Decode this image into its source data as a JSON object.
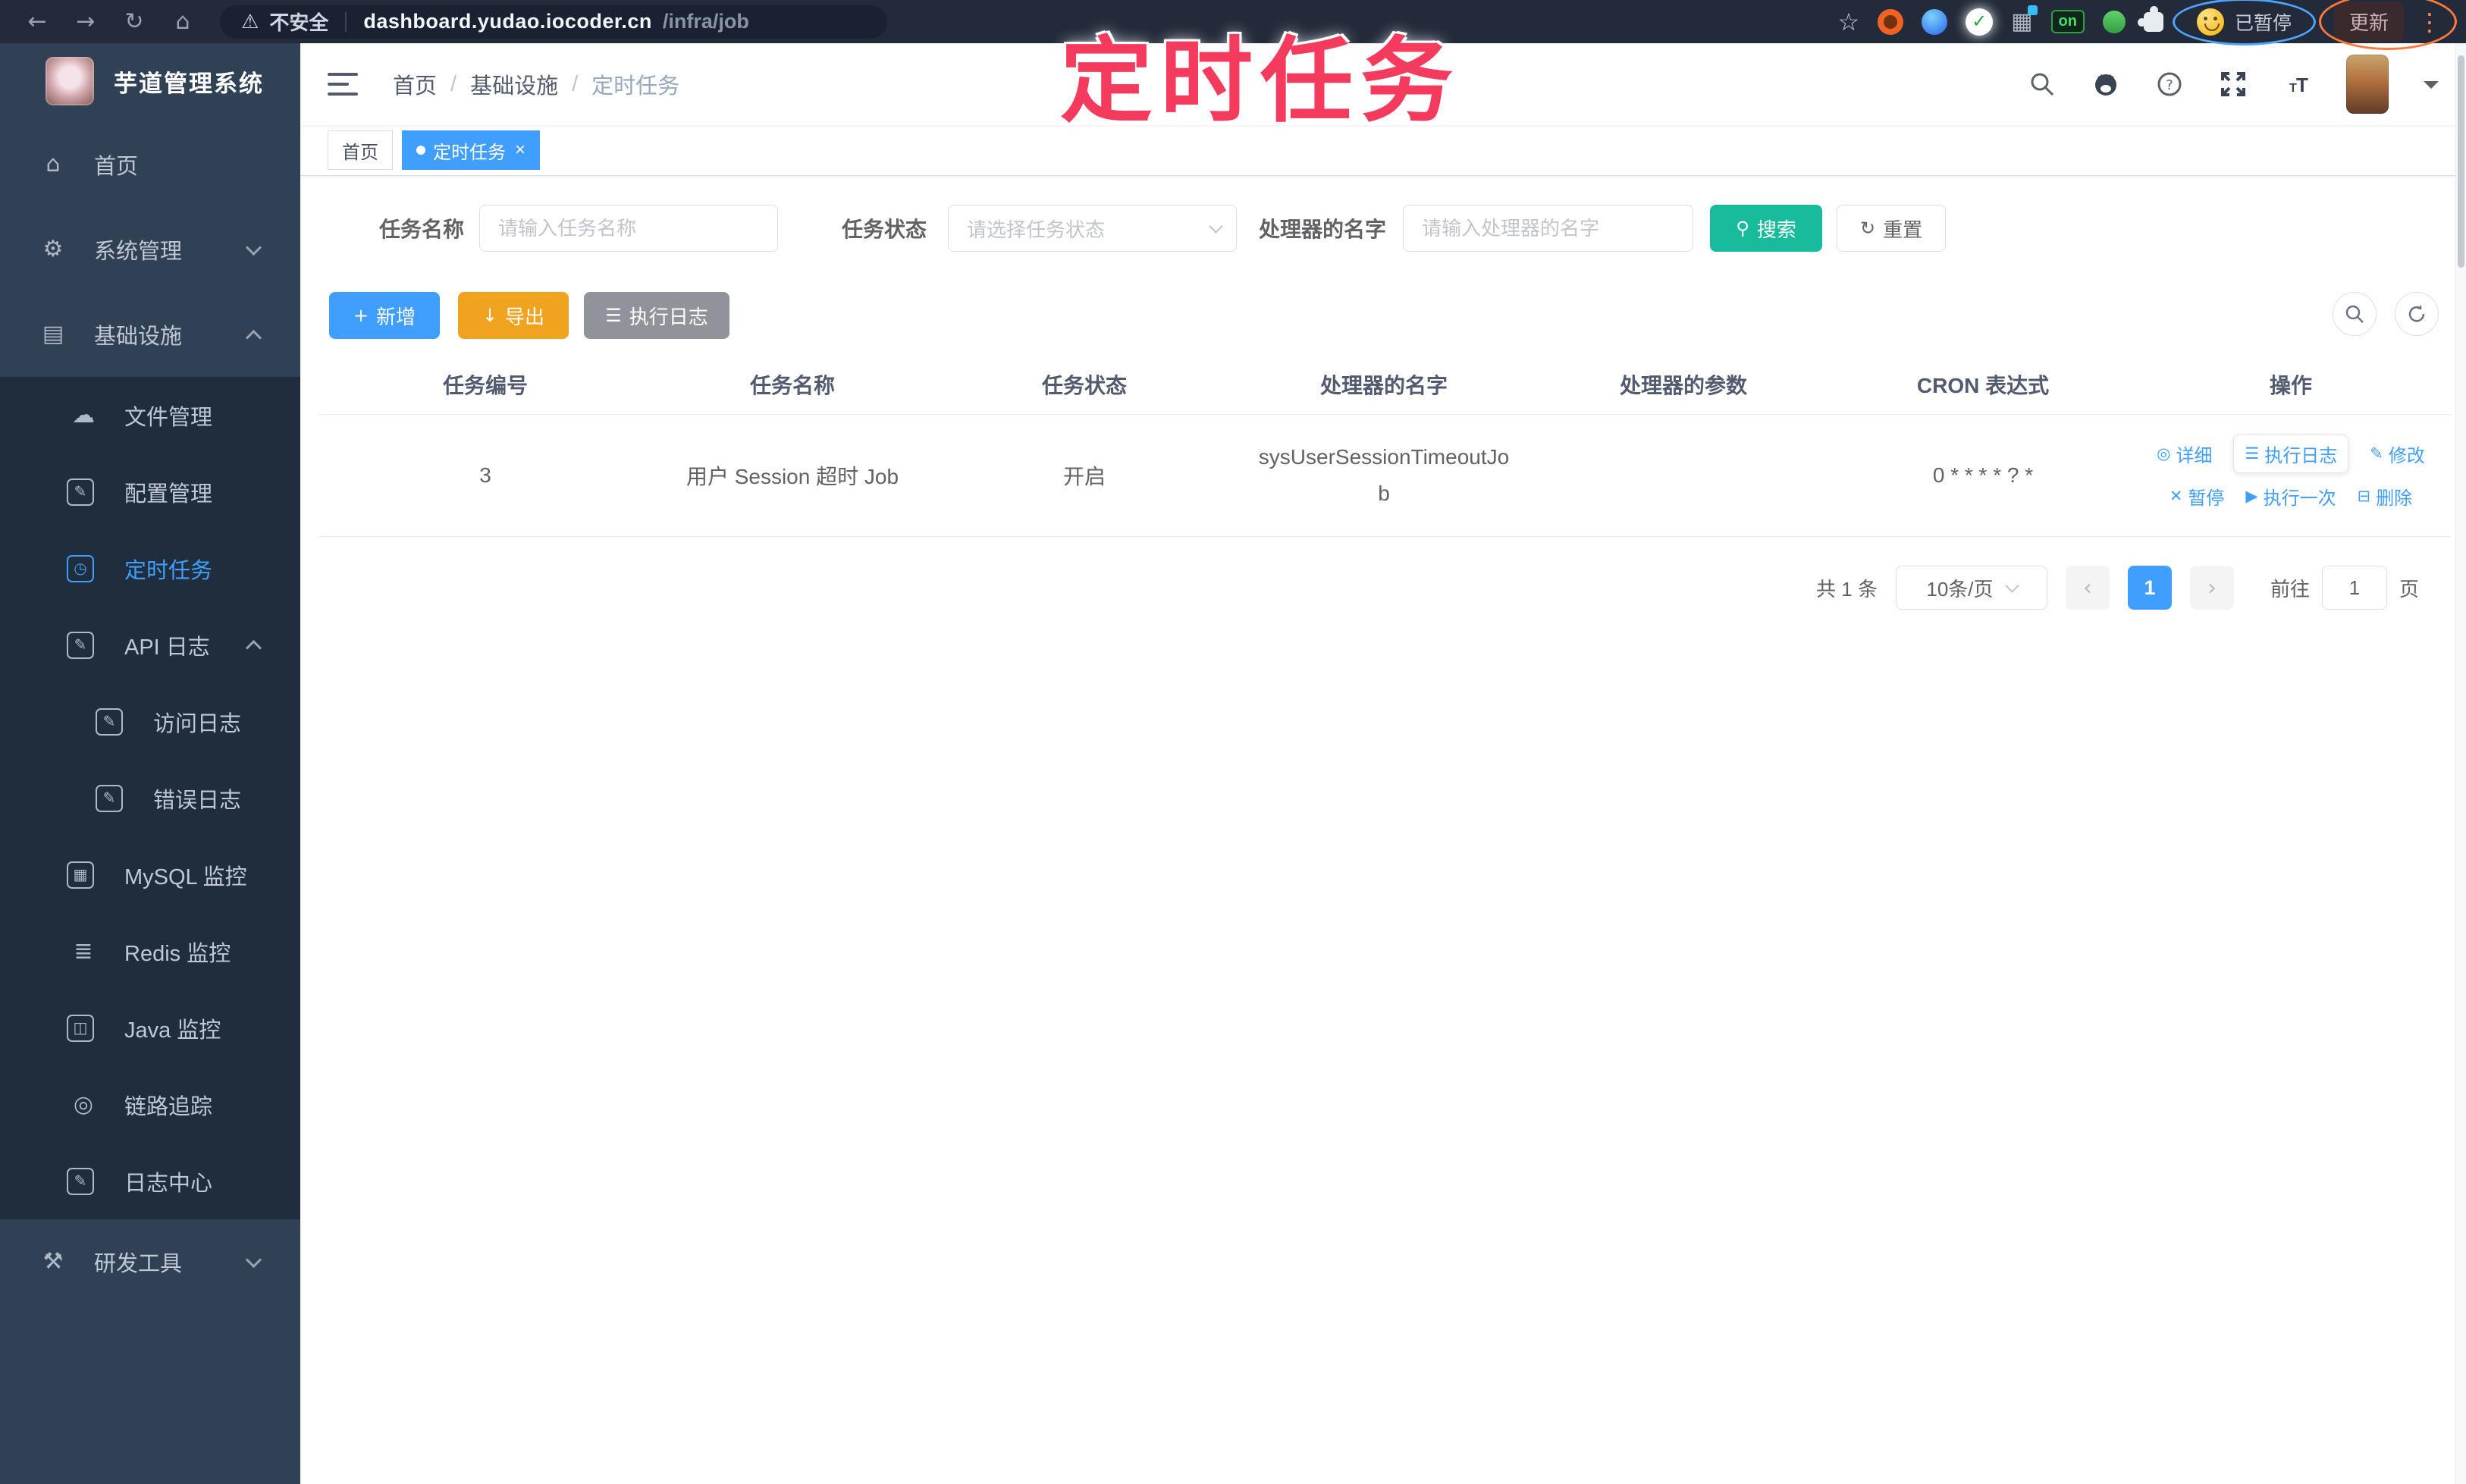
{
  "browser": {
    "security": "不安全",
    "url_host": "dashboard.yudao.iocoder.cn",
    "url_path": "/infra/job",
    "on_badge": "on",
    "paused_badge": "已暂停",
    "update_button": "更新"
  },
  "annotation": {
    "text": "定时任务"
  },
  "sidebar": {
    "title": "芋道管理系统",
    "items": [
      {
        "id": "home",
        "icon": "home-icon",
        "glyph": "⌂",
        "label": "首页",
        "level": 0
      },
      {
        "id": "system",
        "icon": "gear-icon",
        "glyph": "⚙",
        "label": "系统管理",
        "level": 0,
        "chevron": "down"
      },
      {
        "id": "infra",
        "icon": "monitor-icon",
        "glyph": "▤",
        "label": "基础设施",
        "level": 0,
        "chevron": "up"
      },
      {
        "id": "file",
        "icon": "cloud-upload-icon",
        "glyph": "☁",
        "label": "文件管理",
        "level": 1,
        "sub": true
      },
      {
        "id": "config",
        "icon": "edit-icon",
        "glyph": "✎",
        "label": "配置管理",
        "level": 1,
        "sub": true,
        "boxed": true
      },
      {
        "id": "job",
        "icon": "clock-icon",
        "glyph": "◷",
        "label": "定时任务",
        "level": 1,
        "sub": true,
        "boxed": true,
        "active": true
      },
      {
        "id": "api-log",
        "icon": "log-icon",
        "glyph": "✎",
        "label": "API 日志",
        "level": 1,
        "sub": true,
        "boxed": true,
        "chevron": "up"
      },
      {
        "id": "access-log",
        "icon": "log-icon",
        "glyph": "✎",
        "label": "访问日志",
        "level": 2,
        "sub": true,
        "boxed": true
      },
      {
        "id": "error-log",
        "icon": "log-icon",
        "glyph": "✎",
        "label": "错误日志",
        "level": 2,
        "sub": true,
        "boxed": true
      },
      {
        "id": "mysql",
        "icon": "database-icon",
        "glyph": "▦",
        "label": "MySQL 监控",
        "level": 1,
        "sub": true,
        "boxed": true
      },
      {
        "id": "redis",
        "icon": "stack-icon",
        "glyph": "≣",
        "label": "Redis 监控",
        "level": 1,
        "sub": true
      },
      {
        "id": "java",
        "icon": "java-icon",
        "glyph": "◫",
        "label": "Java 监控",
        "level": 1,
        "sub": true,
        "boxed": true
      },
      {
        "id": "trace",
        "icon": "eye-icon",
        "glyph": "◎",
        "label": "链路追踪",
        "level": 1,
        "sub": true
      },
      {
        "id": "log-center",
        "icon": "log-icon",
        "glyph": "✎",
        "label": "日志中心",
        "level": 1,
        "sub": true,
        "boxed": true
      },
      {
        "id": "devtool",
        "icon": "toolbox-icon",
        "glyph": "⚒",
        "label": "研发工具",
        "level": 0,
        "chevron": "down"
      }
    ]
  },
  "breadcrumb": [
    "首页",
    "基础设施",
    "定时任务"
  ],
  "tabs": [
    {
      "name": "tab-home",
      "label": "首页",
      "active": false,
      "closable": false
    },
    {
      "name": "tab-job",
      "label": "定时任务",
      "active": true,
      "closable": true
    }
  ],
  "filters": {
    "name_label": "任务名称",
    "name_placeholder": "请输入任务名称",
    "status_label": "任务状态",
    "status_placeholder": "请选择任务状态",
    "handler_label": "处理器的名字",
    "handler_placeholder": "请输入处理器的名字",
    "search": "搜索",
    "reset": "重置"
  },
  "toolbar": {
    "add": "新增",
    "export": "导出",
    "exec_log": "执行日志"
  },
  "table": {
    "headers": [
      "任务编号",
      "任务名称",
      "任务状态",
      "处理器的名字",
      "处理器的参数",
      "CRON 表达式",
      "操作"
    ],
    "rows": [
      {
        "id": "3",
        "name": "用户 Session 超时 Job",
        "status": "开启",
        "handler": "sysUserSessionTimeoutJob",
        "params": "",
        "cron": "0 * * * * ? *",
        "actions": [
          [
            {
              "name": "detail",
              "label": "详细",
              "icon": "eye-icon",
              "glyph": "◎"
            },
            {
              "name": "exec-log",
              "label": "执行日志",
              "icon": "list-icon",
              "glyph": "☰",
              "boxed": true
            },
            {
              "name": "edit",
              "label": "修改",
              "icon": "edit-icon",
              "glyph": "✎"
            }
          ],
          [
            {
              "name": "pause",
              "label": "暂停",
              "icon": "pause-icon",
              "glyph": "✕"
            },
            {
              "name": "run-once",
              "label": "执行一次",
              "icon": "play-icon",
              "glyph": "▶"
            },
            {
              "name": "delete",
              "label": "删除",
              "icon": "delete-icon",
              "glyph": "⊟"
            }
          ]
        ]
      }
    ]
  },
  "pagination": {
    "total": "共 1 条",
    "page_size": "10条/页",
    "page": "1",
    "goto": "前往",
    "goto_value": "1",
    "unit": "页"
  },
  "colors": {
    "primary": "#409eff",
    "search_button": "#18bc9c",
    "export_button": "#f0a31f",
    "info_button": "#909399",
    "sidebar_bg": "#304156",
    "submenu_bg": "#1f2d3d",
    "annotation": "#f43b5e"
  }
}
